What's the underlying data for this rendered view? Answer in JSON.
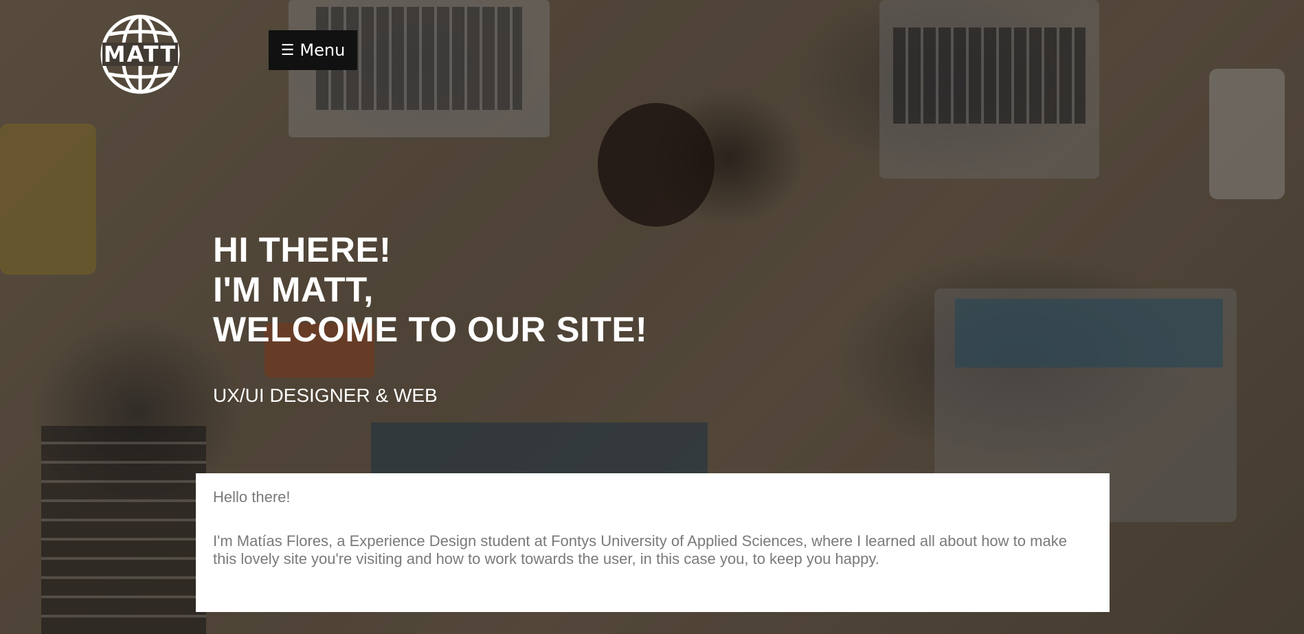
{
  "logo": {
    "text": "MATT",
    "icon": "globe-icon"
  },
  "nav": {
    "menu_label": "Menu",
    "menu_icon": "hamburger-icon"
  },
  "hero": {
    "line1": "HI THERE!",
    "line2": "I'M MATT,",
    "line3": "WELCOME TO OUR SITE!",
    "subtitle": "UX/UI DESIGNER & WEB"
  },
  "intro": {
    "greeting": "Hello there!",
    "body": "I'm Matías Flores, a Experience Design student at Fontys University of Applied Sciences, where I learned all about how to make this lovely site you're visiting and how to work towards the user, in this case you, to keep you happy."
  },
  "colors": {
    "menu_bg": "#111111",
    "text_light": "#ffffff",
    "card_bg": "#ffffff",
    "card_text": "#7a7a7a"
  }
}
